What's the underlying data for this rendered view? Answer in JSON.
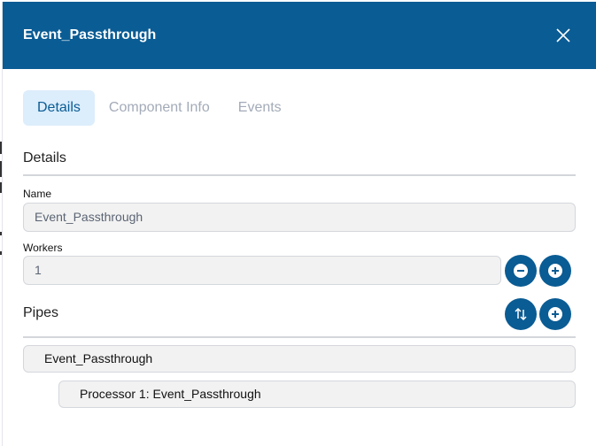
{
  "modal": {
    "title": "Event_Passthrough",
    "close_icon": "close-icon"
  },
  "tabs": [
    {
      "label": "Details",
      "active": true
    },
    {
      "label": "Component Info",
      "active": false
    },
    {
      "label": "Events",
      "active": false
    }
  ],
  "details": {
    "section_title": "Details",
    "name_label": "Name",
    "name_value": "Event_Passthrough",
    "workers_label": "Workers",
    "workers_value": "1",
    "decrement_icon": "minus-circle-icon",
    "increment_icon": "plus-circle-icon"
  },
  "pipes": {
    "section_title": "Pipes",
    "sort_icon": "sort-arrows-icon",
    "add_icon": "plus-circle-icon",
    "items": [
      {
        "label": "Event_Passthrough",
        "level": 0
      },
      {
        "label": "Processor 1: Event_Passthrough",
        "level": 1
      }
    ]
  },
  "colors": {
    "brand": "#0a5c94",
    "tab_active_bg": "#dcedfb",
    "tab_inactive_text": "#a3abb8"
  }
}
